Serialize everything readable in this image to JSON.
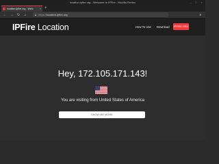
{
  "window": {
    "title": "location.ipfire.org - Welcome to IPFire - Mozilla Firefox",
    "controls": [
      "–",
      "□",
      "×"
    ]
  },
  "tabs": [
    {
      "label": "location.ipfire.org - Welc",
      "close": "×"
    }
  ],
  "new_tab_label": "+",
  "navbar": {
    "back_icon": "arrow-left",
    "forward_icon": "arrow-right",
    "reload_icon": "reload",
    "home_icon": "home",
    "url_prefix": "https://",
    "url_host": "location.ipfire.org",
    "menu_icon": "hamburger"
  },
  "site": {
    "logo_bold": "IPFire",
    "logo_light": " Location",
    "nav": [
      {
        "label": "How-To Use"
      },
      {
        "label": "Download"
      }
    ],
    "cta_label": "IPFIRE.ORG"
  },
  "hero": {
    "title": "Hey, 172.105.171.143!",
    "visiting": "You are visiting from United States of America",
    "button": "SHOW ME MORE"
  },
  "colors": {
    "accent": "#ef3a3e",
    "page_bg": "#2d2d2d",
    "header_bg": "#1e1e1e"
  }
}
